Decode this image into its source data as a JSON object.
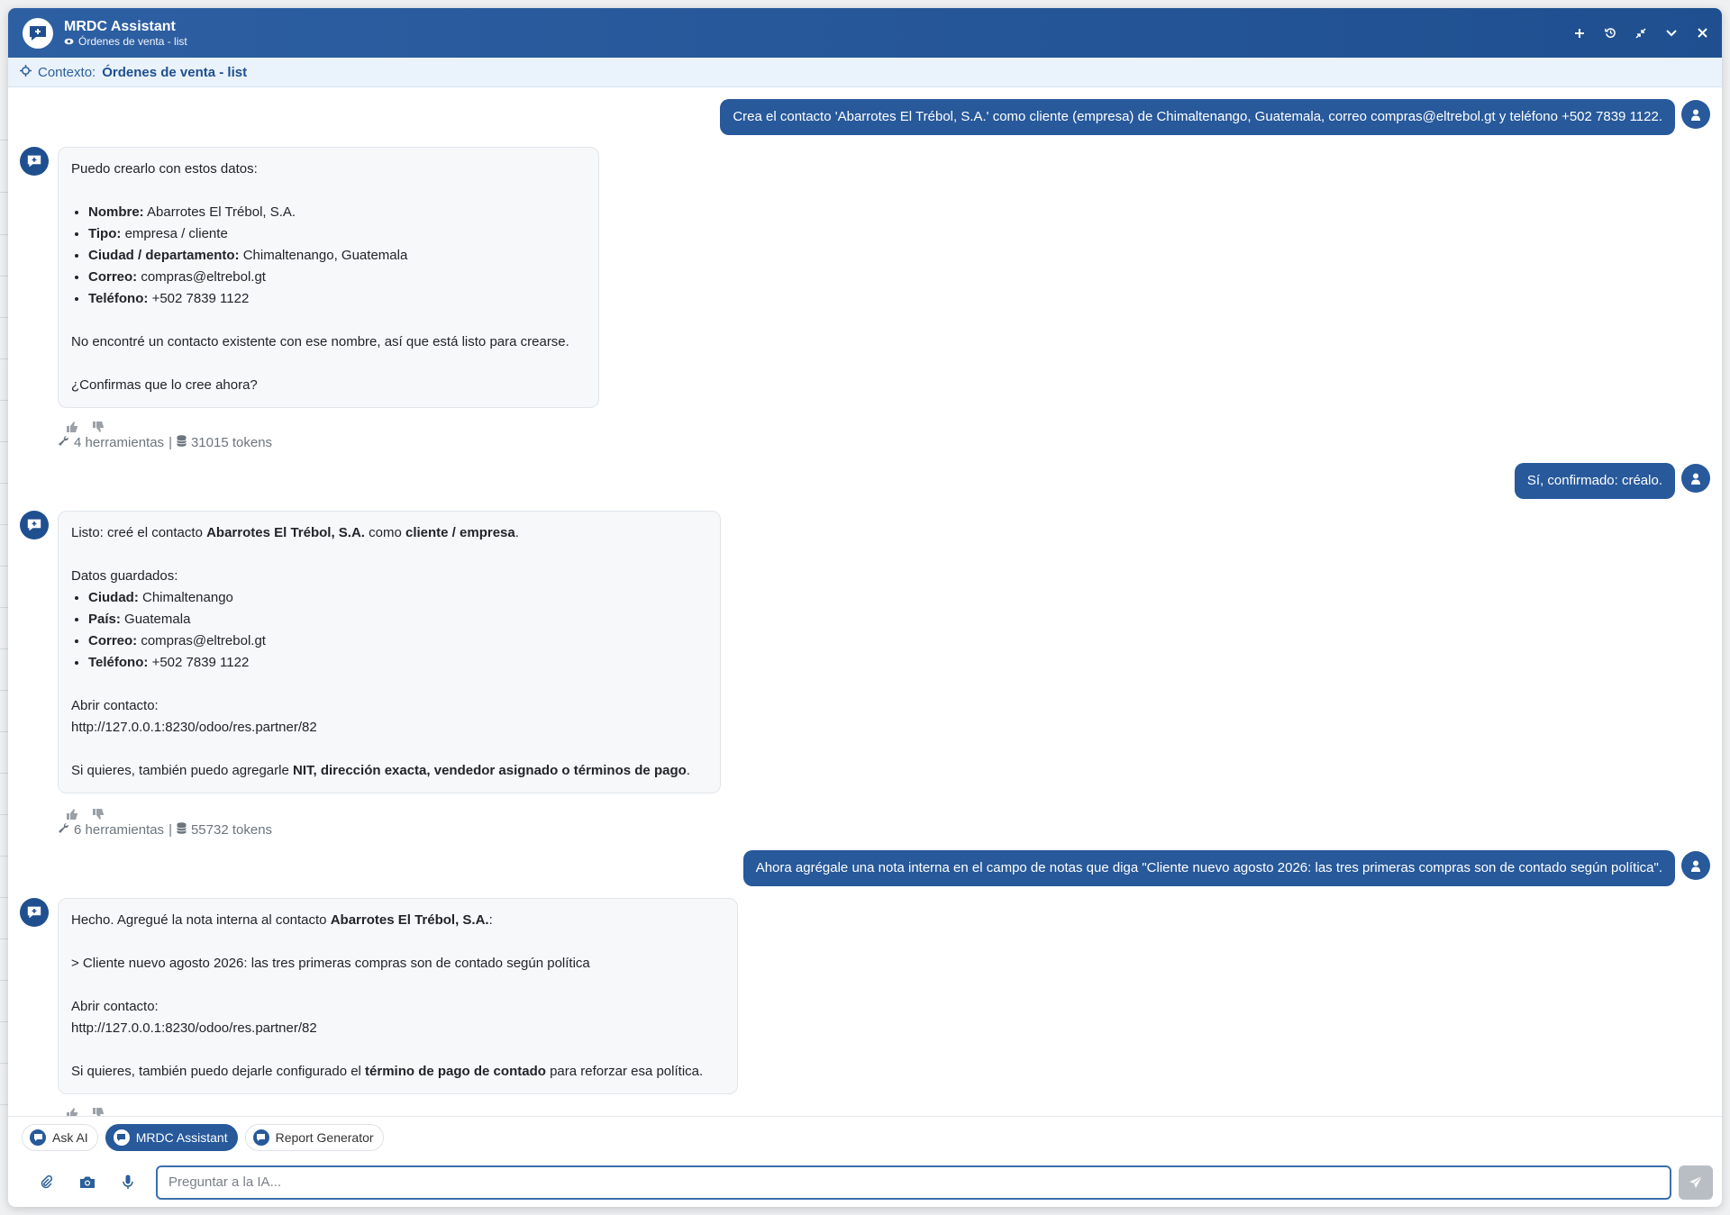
{
  "window": {
    "title": "MRDC Assistant",
    "subtitle": "Órdenes de venta - list",
    "actions": [
      "new-chat-icon",
      "history-icon",
      "compress-icon",
      "minimize-icon",
      "close-icon"
    ]
  },
  "context": {
    "label": "Contexto:",
    "value": "Órdenes de venta - list"
  },
  "messages": {
    "u1": "Crea el contacto 'Abarrotes El Trébol, S.A.' como cliente (empresa) de Chimaltenango, Guatemala, correo compras@eltrebol.gt y teléfono +502 7839 1122.",
    "b1": {
      "intro": "Puedo crearlo con estos datos:",
      "items": [
        {
          "k": "Nombre:",
          "v": "Abarrotes El Trébol, S.A."
        },
        {
          "k": "Tipo:",
          "v": "empresa / cliente"
        },
        {
          "k": "Ciudad / departamento:",
          "v": "Chimaltenango, Guatemala"
        },
        {
          "k": "Correo:",
          "v": "compras@eltrebol.gt"
        },
        {
          "k": "Teléfono:",
          "v": "+502 7839 1122"
        }
      ],
      "p2": "No encontré un contacto existente con ese nombre, así que está listo para crearse.",
      "p3": "¿Confirmas que lo cree ahora?",
      "tools": "4 herramientas",
      "sep": "|",
      "tokens": "31015 tokens"
    },
    "u2": "Sí, confirmado: créalo.",
    "b2": {
      "l1a": "Listo: creé el contacto ",
      "l1b": "Abarrotes El Trébol, S.A.",
      "l1c": " como ",
      "l1d": "cliente / empresa",
      "l1e": ".",
      "saved": "Datos guardados:",
      "items": [
        {
          "k": "Ciudad:",
          "v": "Chimaltenango"
        },
        {
          "k": "País:",
          "v": "Guatemala"
        },
        {
          "k": "Correo:",
          "v": "compras@eltrebol.gt"
        },
        {
          "k": "Teléfono:",
          "v": "+502 7839 1122"
        }
      ],
      "open": "Abrir contacto:",
      "url": "http://127.0.0.1:8230/odoo/res.partner/82",
      "la": "Si quieres, también puedo agregarle ",
      "lb": "NIT, dirección exacta, vendedor asignado o términos de pago",
      "lc": ".",
      "tools": "6 herramientas",
      "sep": "|",
      "tokens": "55732 tokens"
    },
    "u3": "Ahora agrégale una nota interna en el campo de notas que diga \"Cliente nuevo agosto 2026: las tres primeras compras son de contado según política\".",
    "b3": {
      "l1a": "Hecho. Agregué la nota interna al contacto ",
      "l1b": "Abarrotes El Trébol, S.A.",
      "l1c": ":",
      "quote": "> Cliente nuevo agosto 2026: las tres primeras compras son de contado según política",
      "open": "Abrir contacto:",
      "url": "http://127.0.0.1:8230/odoo/res.partner/82",
      "la": "Si quieres, también puedo dejarle configurado el ",
      "lb": "término de pago de contado",
      "lc": " para reforzar esa política."
    }
  },
  "tabs": [
    "Ask AI",
    "MRDC Assistant",
    "Report Generator"
  ],
  "active_tab": "MRDC Assistant",
  "input": {
    "placeholder": "Preguntar a la IA...",
    "value": ""
  },
  "colors": {
    "header": "#1f4f8f",
    "user_bubble": "#27599b",
    "context_bg": "#eaf2fb"
  }
}
